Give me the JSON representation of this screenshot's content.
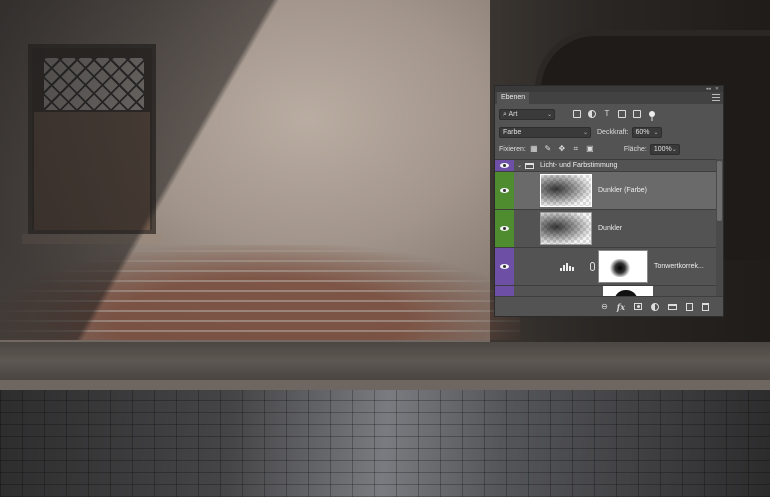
{
  "panel": {
    "tab_label": "Ebenen",
    "filter": {
      "kind_label": "Art"
    },
    "blend": {
      "mode": "Farbe",
      "opacity_label": "Deckkraft:",
      "opacity_value": "60%"
    },
    "lock": {
      "lock_label": "Fixieren:",
      "fill_label": "Fläche:",
      "fill_value": "100%"
    },
    "layers": [
      {
        "type": "group",
        "name": "Licht- und Farbstimmung",
        "visible": true,
        "expanded": true,
        "color_tag": "#6d4fa6"
      },
      {
        "type": "pixel",
        "name": "Dunkler (Farbe)",
        "visible": true,
        "selected": true,
        "color_tag": "#4f8b2f"
      },
      {
        "type": "pixel",
        "name": "Dunkler",
        "visible": true,
        "selected": false,
        "color_tag": "#4f8b2f"
      },
      {
        "type": "adjustment",
        "name": "Tonwertkorrek...",
        "visible": true,
        "color_tag": "#6d4fa6",
        "icon": "levels-icon"
      },
      {
        "type": "partial",
        "name": "",
        "visible": false,
        "color_tag": "#6d4fa6"
      }
    ],
    "bottom_icons": [
      "link-icon",
      "fx-icon",
      "mask-icon",
      "adjustment-icon",
      "folder-icon",
      "new-layer-icon",
      "trash-icon"
    ],
    "filter_icons": [
      "pixel-filter-icon",
      "adjustment-filter-icon",
      "type-filter-icon",
      "shape-filter-icon",
      "smart-object-filter-icon"
    ],
    "lock_icons": [
      "lock-transparent-icon",
      "lock-pixels-icon",
      "lock-position-icon",
      "lock-artboard-icon",
      "lock-all-icon"
    ]
  }
}
